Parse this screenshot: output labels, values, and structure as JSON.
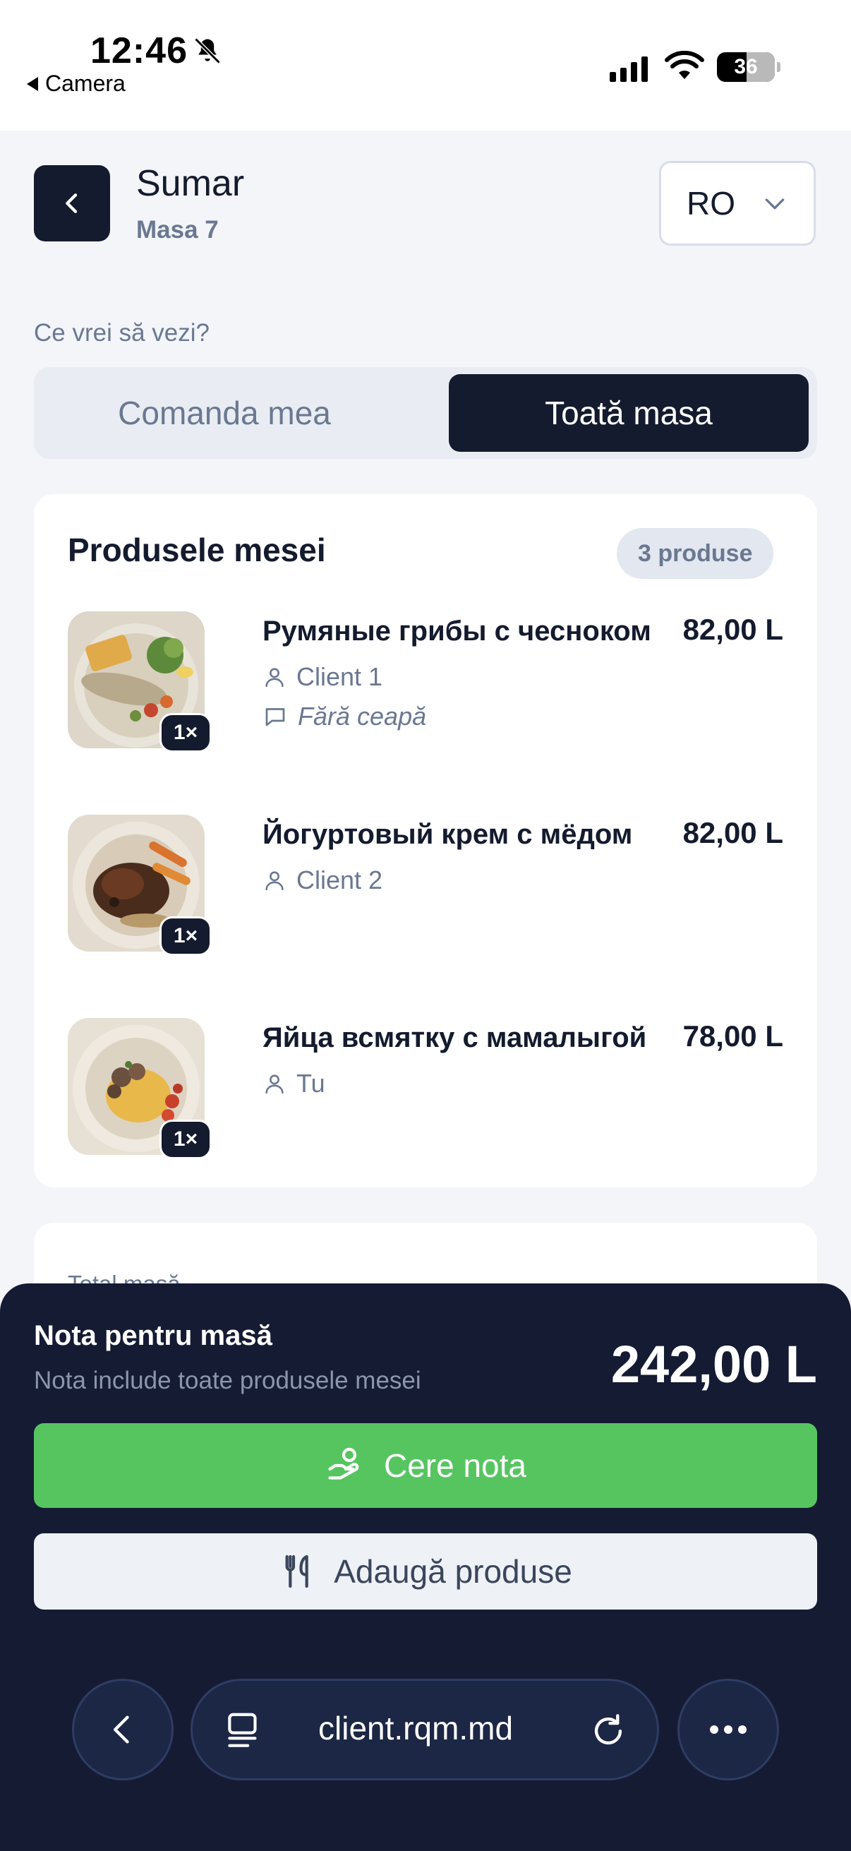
{
  "status_bar": {
    "time": "12:46",
    "back_app": "Camera",
    "battery": "36"
  },
  "header": {
    "title": "Sumar",
    "subtitle": "Masa 7",
    "language": "RO"
  },
  "view_selector": {
    "question": "Ce vrei să vezi?",
    "options": [
      "Comanda mea",
      "Toată masa"
    ],
    "selected": "Toată masa"
  },
  "products_card": {
    "title": "Produsele mesei",
    "count_badge": "3 produse",
    "items": [
      {
        "name": "Румяные грибы с чесноком",
        "price": "82,00 L",
        "client": "Client 1",
        "note": "Fără ceapă",
        "qty": "1×"
      },
      {
        "name": "Йогуртовый крем с мёдом",
        "price": "82,00 L",
        "client": "Client 2",
        "qty": "1×"
      },
      {
        "name": "Яйца всмятку с мамалыгой",
        "price": "78,00 L",
        "client": "Tu",
        "qty": "1×"
      }
    ]
  },
  "total_card": {
    "label": "Total masă"
  },
  "bill_sheet": {
    "title": "Nota pentru masă",
    "subtitle": "Nota include toate produsele mesei",
    "total": "242,00 L",
    "request_button": "Cere nota",
    "add_button": "Adaugă produse"
  },
  "browser": {
    "url": "client.rqm.md"
  },
  "colors": {
    "primary_dark": "#141b2e",
    "sheet_bg": "#141b33",
    "accent_green": "#56c560",
    "muted_text": "#6a7891"
  }
}
